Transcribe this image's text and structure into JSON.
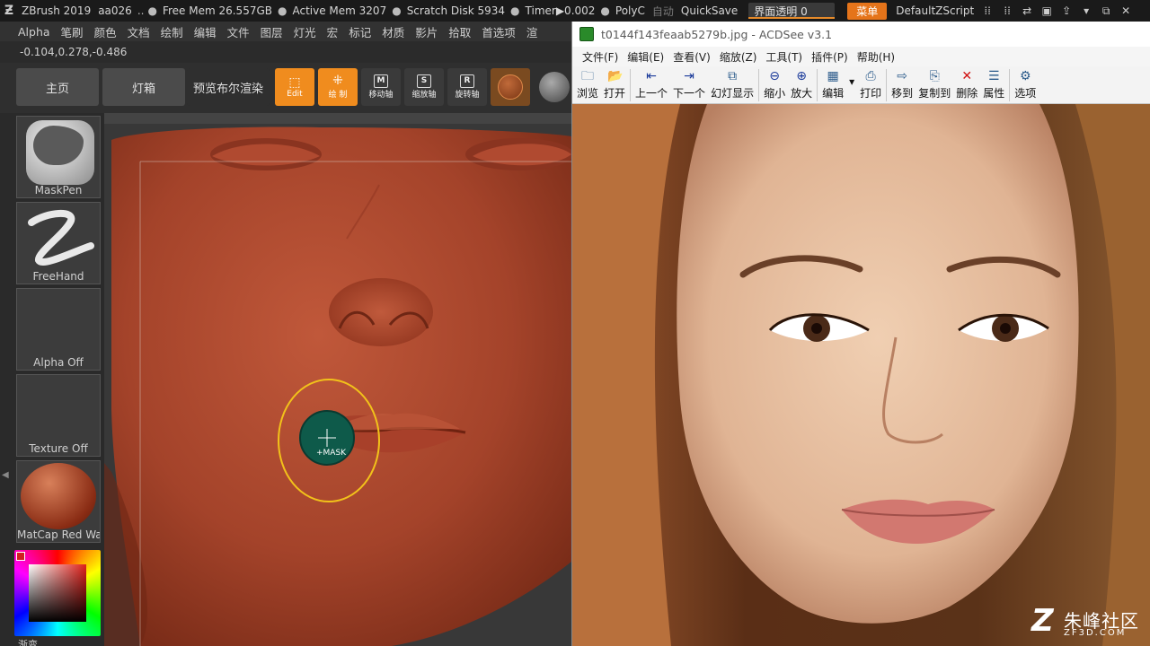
{
  "zbrush": {
    "titlebar": {
      "app": "ZBrush 2019",
      "doc": "aa026",
      "ellipsis": "..",
      "free_mem": "Free Mem 26.557GB",
      "active_mem": "Active Mem 3207",
      "scratch": "Scratch Disk 5934",
      "timer": "Timer▶0.002",
      "poly": "PolyC",
      "auto": "自动",
      "quicksave": "QuickSave",
      "transparency": "界面透明 0",
      "menu": "菜单",
      "script": "DefaultZScript"
    },
    "menus": [
      "Alpha",
      "笔刷",
      "颜色",
      "文档",
      "绘制",
      "编辑",
      "文件",
      "图层",
      "灯光",
      "宏",
      "标记",
      "材质",
      "影片",
      "拾取",
      "首选项",
      "渲"
    ],
    "coords": "-0.104,0.278,-0.486",
    "shelf": {
      "home": "主页",
      "lightbox": "灯箱",
      "preview_render": "预览布尔渲染",
      "edit": "Edit",
      "draw": "绘 制",
      "move": "移动轴",
      "scale": "缩放轴",
      "rotate": "旋转轴"
    },
    "tray": {
      "brush": "MaskPen",
      "stroke": "FreeHand",
      "alpha": "Alpha Off",
      "texture": "Texture Off",
      "material": "MatCap Red Wax",
      "gradient": "渐变"
    },
    "cursor_label": "+MASK",
    "colors": {
      "accent": "#f08c1e",
      "clay": "#a8442c",
      "mask": "#0e5a4a",
      "ring": "#f2c21a"
    }
  },
  "acdsee": {
    "title": "t0144f143feaab5279b.jpg - ACDSee v3.1",
    "menus": [
      "文件(F)",
      "编辑(E)",
      "查看(V)",
      "缩放(Z)",
      "工具(T)",
      "插件(P)",
      "帮助(H)"
    ],
    "toolbar": [
      {
        "label": "浏览",
        "icon": "browse-icon"
      },
      {
        "label": "打开",
        "icon": "open-folder-icon"
      },
      {
        "label": "上一个",
        "icon": "prev-icon"
      },
      {
        "label": "下一个",
        "icon": "next-icon"
      },
      {
        "label": "幻灯显示",
        "icon": "slideshow-icon"
      },
      {
        "label": "缩小",
        "icon": "zoom-out-icon"
      },
      {
        "label": "放大",
        "icon": "zoom-in-icon"
      },
      {
        "label": "编辑",
        "icon": "edit-icon"
      },
      {
        "label": "打印",
        "icon": "print-icon"
      },
      {
        "label": "移到",
        "icon": "move-to-icon"
      },
      {
        "label": "复制到",
        "icon": "copy-to-icon"
      },
      {
        "label": "删除",
        "icon": "delete-icon"
      },
      {
        "label": "属性",
        "icon": "properties-icon"
      },
      {
        "label": "选项",
        "icon": "options-icon"
      }
    ]
  },
  "watermark": {
    "logo": "Z",
    "name": "朱峰社区",
    "domain": "ZF3D.COM"
  }
}
